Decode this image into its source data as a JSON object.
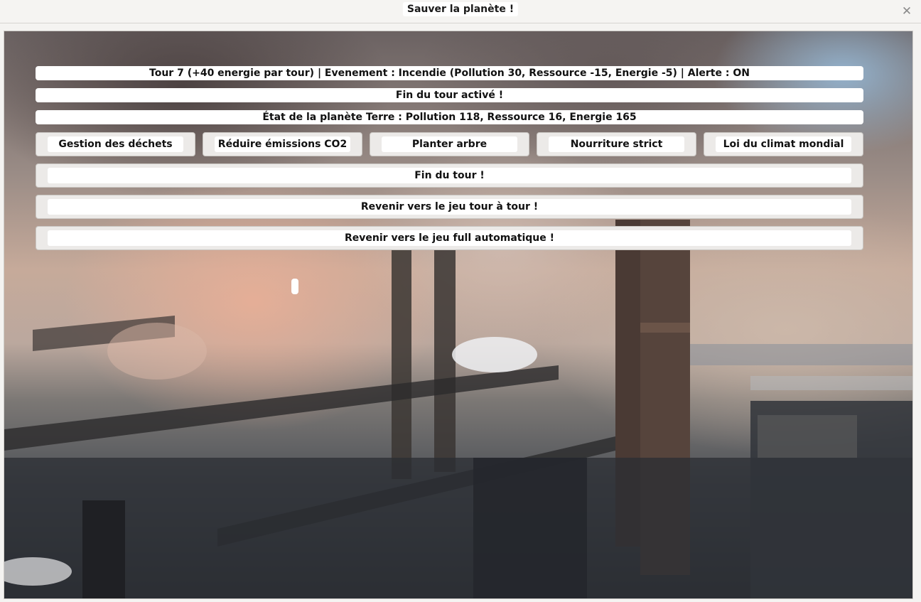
{
  "window": {
    "title": "Sauver la planète !",
    "close_icon": "close-icon"
  },
  "status": {
    "turn_line": "Tour 7 (+40 energie par tour) | Evenement : Incendie (Pollution 30, Ressource -15, Energie -5) | Alerte : ON",
    "end_turn_notice": "Fin du tour activé !",
    "planet_state": "État de la planète Terre : Pollution 118, Ressource 16, Energie 165"
  },
  "actions": [
    {
      "label": "Gestion des déchets"
    },
    {
      "label": "Réduire émissions CO2"
    },
    {
      "label": "Planter arbre"
    },
    {
      "label": "Nourriture strict"
    },
    {
      "label": "Loi du climat mondial"
    }
  ],
  "controls": {
    "end_turn": "Fin du tour !",
    "back_turn_based": "Revenir vers le jeu tour à tour !",
    "back_full_auto": "Revenir vers le jeu full automatique !"
  },
  "colors": {
    "panel_text": "#111111",
    "panel_bg": "#ffffff",
    "button_frame": "#eceae8"
  }
}
